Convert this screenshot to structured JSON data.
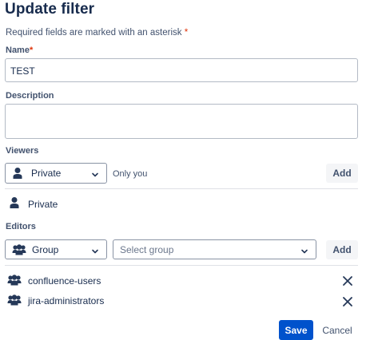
{
  "title": "Update filter",
  "required_note": "Required fields are marked with an asterisk",
  "required_star": "*",
  "name": {
    "label": "Name",
    "star": "*",
    "value": "TEST"
  },
  "description": {
    "label": "Description",
    "value": ""
  },
  "viewers": {
    "label": "Viewers",
    "select_value": "Private",
    "select_icon": "person-icon",
    "hint": "Only you",
    "add_label": "Add",
    "items": [
      {
        "icon": "person-icon",
        "label": "Private"
      }
    ]
  },
  "editors": {
    "label": "Editors",
    "select_value": "Group",
    "select_icon": "group-icon",
    "group_placeholder": "Select group",
    "add_label": "Add",
    "items": [
      {
        "icon": "group-icon",
        "label": "confluence-users",
        "remove_icon": "close-icon"
      },
      {
        "icon": "group-icon",
        "label": "jira-administrators",
        "remove_icon": "close-icon"
      }
    ]
  },
  "actions": {
    "save_label": "Save",
    "cancel_label": "Cancel"
  },
  "colors": {
    "primary": "#0052cc",
    "required": "#de350b",
    "text": "#172b4d",
    "subtle": "#42526e"
  }
}
